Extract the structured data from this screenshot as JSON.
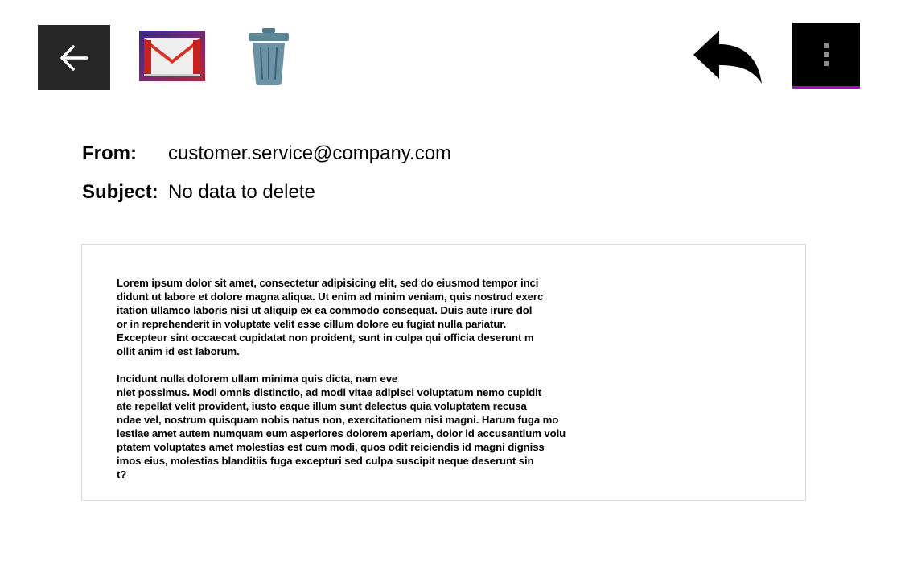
{
  "toolbar": {
    "back": {
      "icon": "arrow-left-icon"
    },
    "gmail": {
      "icon": "gmail-icon"
    },
    "delete": {
      "icon": "trash-icon"
    },
    "reply": {
      "icon": "reply-icon"
    },
    "more": {
      "icon": "more-vertical-icon"
    }
  },
  "colors": {
    "back_bg": "#262626",
    "more_bg": "#000000",
    "more_underline": "#b000d0",
    "trash": "#6a94a6",
    "gmail_red": "#d93025"
  },
  "email": {
    "from_label": "From:",
    "from_value": "customer.service@company.com",
    "subject_label": "Subject:",
    "subject_value": "No data to delete",
    "body": {
      "paragraphs": [
        [
          "Lorem ipsum dolor sit amet, consectetur adipisicing elit, sed do eiusmod tempor inci",
          "didunt ut labore et dolore magna aliqua. Ut enim ad minim veniam, quis nostrud exerc",
          "itation ullamco laboris nisi ut aliquip ex ea commodo consequat. Duis aute irure dol",
          "or in reprehenderit in voluptate velit esse cillum dolore eu fugiat nulla pariatur.",
          "Excepteur sint occaecat cupidatat non proident, sunt in culpa qui officia deserunt m",
          "ollit anim id est laborum."
        ],
        [
          "Incidunt nulla dolorem ullam minima quis dicta, nam eve",
          "niet possimus. Modi omnis distinctio, ad modi vitae adipisci voluptatum nemo cupidit",
          "ate repellat velit provident, iusto eaque illum sunt delectus quia voluptatem recusa",
          "ndae vel, nostrum quisquam nobis natus non, exercitationem nisi magni. Harum fuga mo",
          "lestiae amet autem numquam eum asperiores dolorem aperiam, dolor id accusantium volu",
          "ptatem voluptates amet molestias est cum modi, quos odit reiciendis id magni digniss",
          "imos eius, molestias blanditiis fuga excepturi sed culpa suscipit neque deserunt sin",
          "t?"
        ]
      ]
    }
  }
}
